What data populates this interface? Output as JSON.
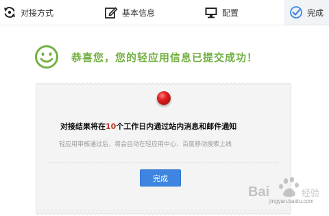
{
  "steps": [
    {
      "label": "对接方式",
      "icon": "sync-icon"
    },
    {
      "label": "基本信息",
      "icon": "edit-icon"
    },
    {
      "label": "配置",
      "icon": "monitor-icon"
    },
    {
      "label": "完成",
      "icon": "check-circle-icon",
      "active": true
    }
  ],
  "success": {
    "headline": "恭喜您，您的轻应用信息已提交成功！",
    "icon": "smiley-icon",
    "color": "#73b042"
  },
  "notice": {
    "before": "对接结果将在",
    "days": "10",
    "after": "个工作日内通过站内消息和邮件通知",
    "sub": "轻应用审核通过后，将会自动在轻应用中心、百度移动搜索上线"
  },
  "button": {
    "label": "完成",
    "color": "#3d85e0"
  },
  "watermark": {
    "text": "Baidu经验",
    "domain": "jingyan.baidu.com"
  }
}
